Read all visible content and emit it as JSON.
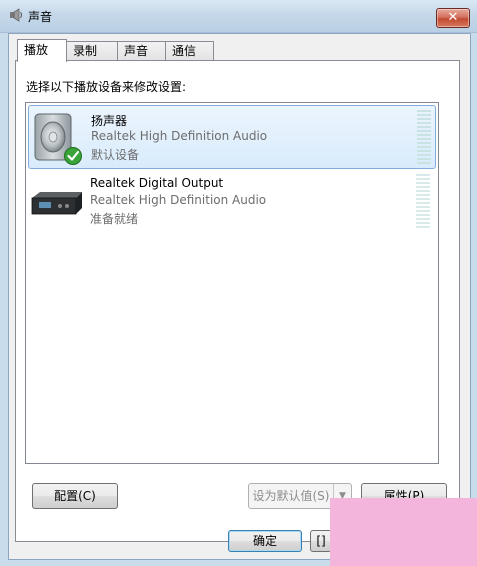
{
  "window": {
    "title": "声音",
    "close_label": "✕"
  },
  "tabs": [
    {
      "label": "播放",
      "active": true
    },
    {
      "label": "录制",
      "active": false
    },
    {
      "label": "声音",
      "active": false
    },
    {
      "label": "通信",
      "active": false
    }
  ],
  "instruction": "选择以下播放设备来修改设置:",
  "devices": [
    {
      "name": "扬声器",
      "description": "Realtek High Definition Audio",
      "status": "默认设备",
      "icon": "speaker-icon",
      "default": true,
      "selected": true
    },
    {
      "name": "Realtek Digital Output",
      "description": "Realtek High Definition Audio",
      "status": "准备就绪",
      "icon": "digital-output-icon",
      "default": false,
      "selected": false
    }
  ],
  "buttons": {
    "configure": "配置(C)",
    "set_default": "设为默认值(S)",
    "properties": "属性(P)",
    "ok": "确定",
    "partial": "[]"
  },
  "colors": {
    "selection_bg": "#d9ecfc",
    "selection_border": "#84acdd",
    "overlay": "#f3b5db"
  }
}
